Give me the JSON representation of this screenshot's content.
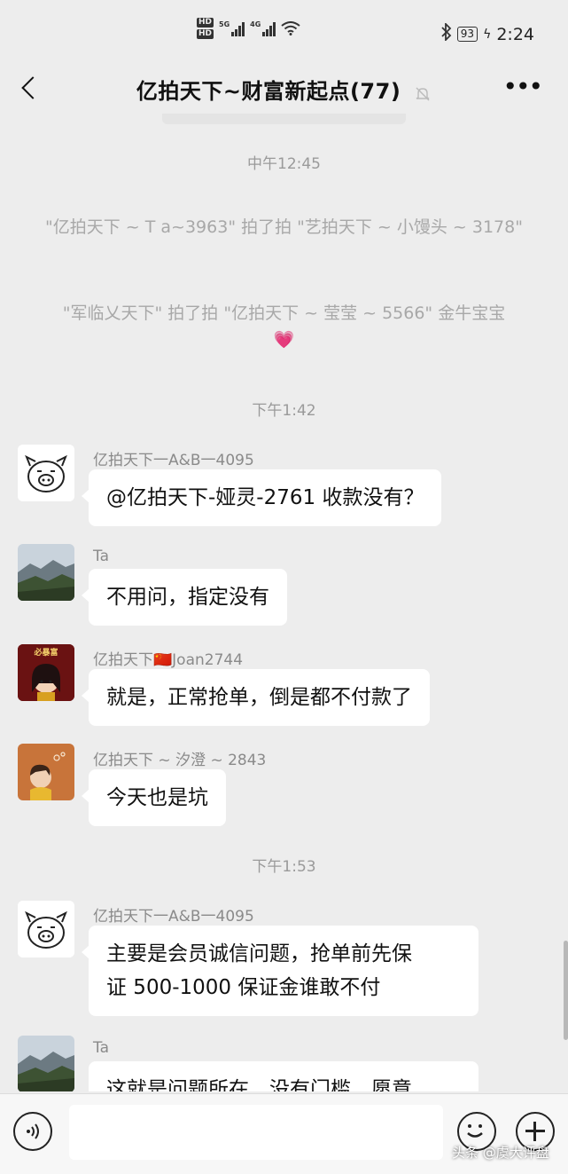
{
  "status_bar": {
    "hd1": "HD",
    "hd2": "HD",
    "sig1_label": "5G",
    "sig2_label": "4G",
    "battery": "93",
    "time": "2:24"
  },
  "nav": {
    "title": "亿拍天下~财富新起点(77)"
  },
  "messages": {
    "time1": "中午12:45",
    "sys1": "\"亿拍天下 ~ T a~3963\" 拍了拍 \"艺拍天下 ~ 小馒头 ~ 3178\"",
    "sys2": "\"军临乂天下\" 拍了拍 \"亿拍天下 ~ 莹莹 ~ 5566\" 金牛宝宝",
    "sys2_emoji": "💗",
    "time2": "下午1:42",
    "m1_nick": "亿拍天下一A&B一4095",
    "m1_text": "@亿拍天下-娅灵-2761 收款没有？",
    "m2_nick": "Ta",
    "m2_text": "不用问，指定没有",
    "m3_nick_prefix": "亿拍天下",
    "m3_flag": "🇨🇳",
    "m3_nick_suffix": "Joan2744",
    "m3_avatar_text": "必暴富",
    "m3_text": "就是，正常抢单，倒是都不付款了",
    "m4_nick": "亿拍天下 ~ 汐澄 ~ 2843",
    "m4_text": "今天也是坑",
    "time3": "下午1:53",
    "m5_nick": "亿拍天下一A&B一4095",
    "m5_line1": "主要是会员诚信问题，抢单前先保",
    "m5_line2": "证 500-1000 保证金谁敢不付",
    "m6_nick": "Ta",
    "m6_text": "这就是问题所在，没有门槛，愿意"
  },
  "watermark": "头条 @虞大评盘",
  "colors": {
    "background": "#ededed",
    "bubble": "#ffffff",
    "system_text": "#a8a8a8"
  }
}
